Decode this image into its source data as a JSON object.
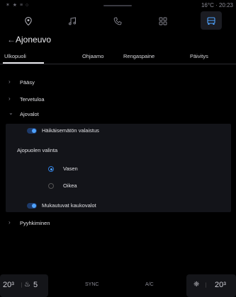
{
  "status_bar": {
    "left_icons": "✶ ★ ≡ ○",
    "right_text": "16°C · 20:23"
  },
  "top_nav": {
    "items": [
      {
        "icon": "location-pin-icon"
      },
      {
        "icon": "music-note-icon"
      },
      {
        "icon": "phone-icon"
      },
      {
        "icon": "apps-grid-icon"
      },
      {
        "icon": "car-icon",
        "active": true
      }
    ]
  },
  "header": {
    "back": "←",
    "title": "Ajoneuvo"
  },
  "tabs": [
    {
      "label": "Ulkopuoli",
      "active": true
    },
    {
      "label": "Ohjaamo"
    },
    {
      "label": "Rengaspaine"
    },
    {
      "label": "Päivitys"
    }
  ],
  "sections": {
    "paasy": "Pääsy",
    "tervetuloa": "Tervetuloa",
    "ajovalot": "Ajovalot",
    "pyyhkiminen": "Pyyhkiminen"
  },
  "ajovalot_panel": {
    "hakaisematon": "Häikäisemätön valaistus",
    "ajopuolen_valinta": "Ajopuolen valinta",
    "vasen": "Vasen",
    "oikea": "Oikea",
    "mukautuvat": "Mukautuvat kaukovalot"
  },
  "bottom_bar": {
    "left_temp": "20³",
    "left_fan": "5",
    "sync": "SYNC",
    "ac": "A/C",
    "right_temp": "20³"
  }
}
